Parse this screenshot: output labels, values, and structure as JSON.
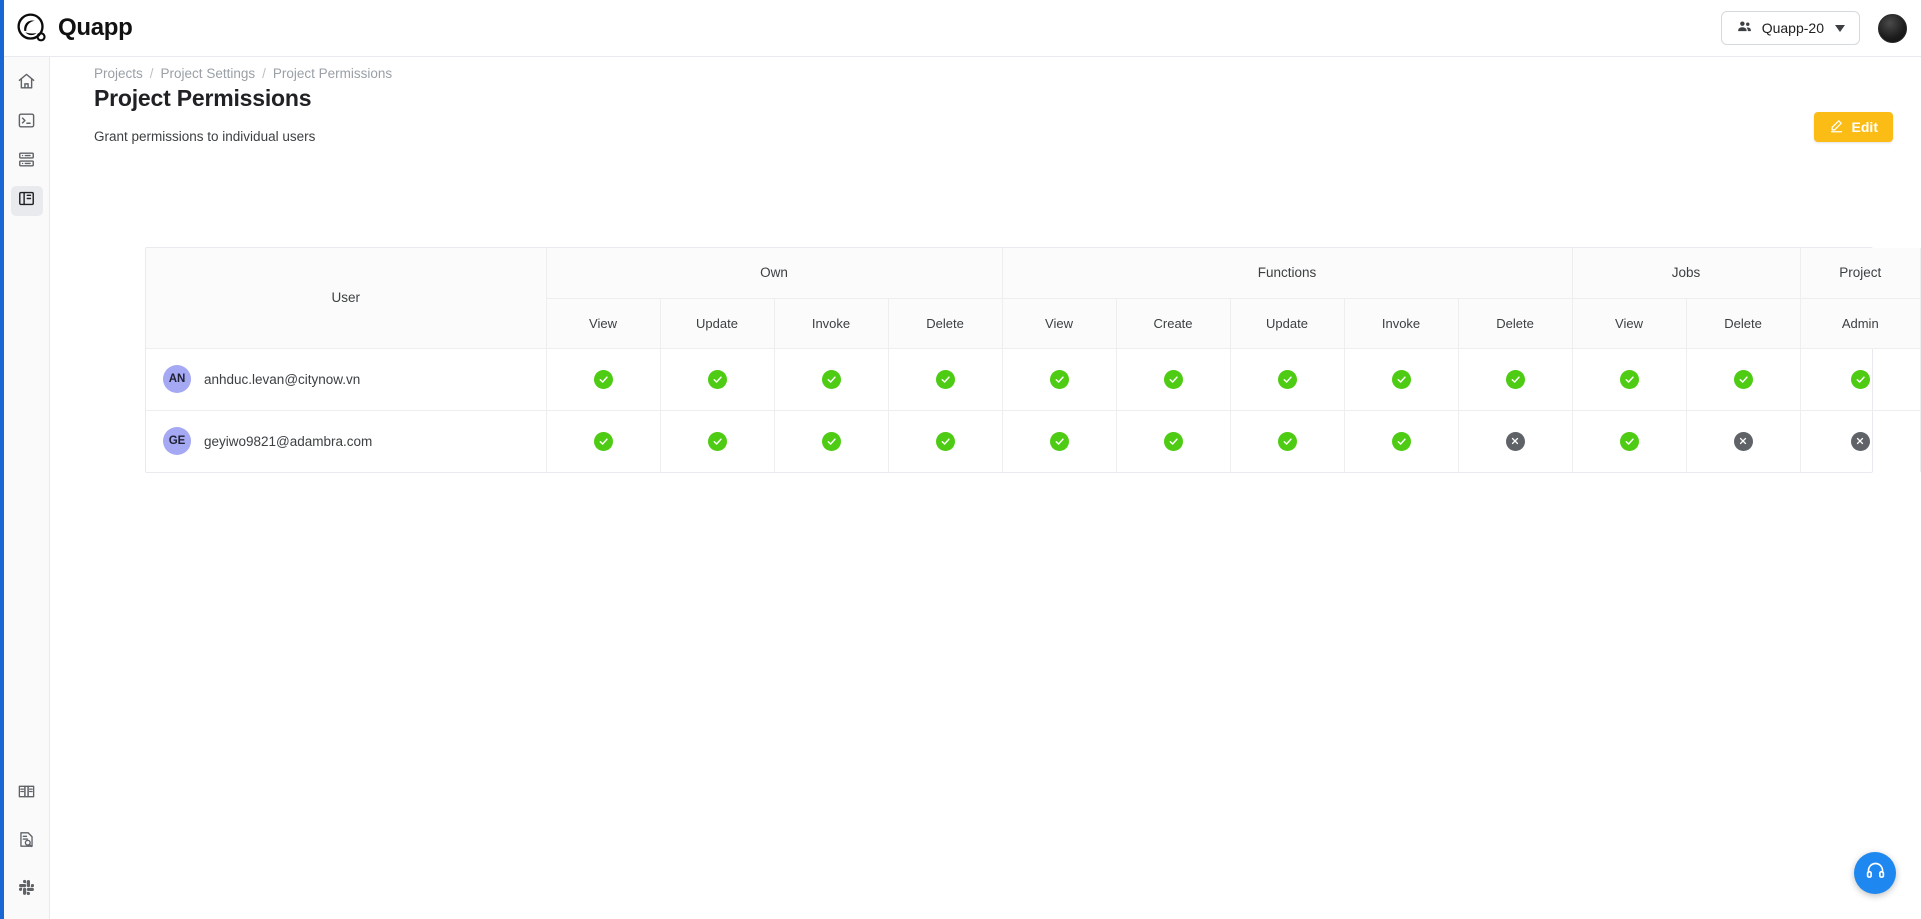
{
  "brand": {
    "name": "Quapp",
    "logo_icon": "quapp-logo-icon"
  },
  "topbar": {
    "org_switcher": {
      "label": "Quapp-20",
      "icon": "people-group-icon",
      "caret_icon": "chevron-down-icon"
    },
    "avatar": {
      "label": ""
    }
  },
  "sidebar": {
    "items": [
      {
        "name": "home",
        "icon": "home-icon",
        "active": false
      },
      {
        "name": "terminal",
        "icon": "terminal-icon",
        "active": false
      },
      {
        "name": "storage",
        "icon": "server-stack-icon",
        "active": false
      },
      {
        "name": "project",
        "icon": "kanban-board-icon",
        "active": true
      }
    ],
    "bottom_items": [
      {
        "name": "docs",
        "icon": "open-book-icon"
      },
      {
        "name": "audit-logs",
        "icon": "document-search-icon"
      },
      {
        "name": "slack",
        "icon": "slack-icon"
      }
    ]
  },
  "breadcrumb": [
    {
      "label": "Projects"
    },
    {
      "label": "Project Settings"
    },
    {
      "label": "Project Permissions"
    }
  ],
  "breadcrumb_separator": "/",
  "page": {
    "title": "Project Permissions",
    "subtitle": "Grant permissions to individual users"
  },
  "actions": {
    "edit": {
      "label": "Edit",
      "icon": "pencil-edit-icon",
      "color": "#fbbc15"
    }
  },
  "table": {
    "user_column_header": "User",
    "groups": [
      {
        "label": "Own",
        "span": 4
      },
      {
        "label": "Functions",
        "span": 5
      },
      {
        "label": "Jobs",
        "span": 2
      },
      {
        "label": "Project",
        "span": 1
      }
    ],
    "sub_headers": [
      "View",
      "Update",
      "Invoke",
      "Delete",
      "View",
      "Create",
      "Update",
      "Invoke",
      "Delete",
      "View",
      "Delete",
      "Admin"
    ],
    "rows": [
      {
        "initials": "AN",
        "email": "anhduc.levan@citynow.vn",
        "avatar_color": "#a5a8f3",
        "permissions": [
          true,
          true,
          true,
          true,
          true,
          true,
          true,
          true,
          true,
          true,
          true,
          true
        ]
      },
      {
        "initials": "GE",
        "email": "geyiwo9821@adambra.com",
        "avatar_color": "#a5a8f3",
        "permissions": [
          true,
          true,
          true,
          true,
          true,
          true,
          true,
          true,
          false,
          true,
          false,
          false
        ]
      }
    ],
    "allow_icon": "check-circle-icon",
    "deny_icon": "x-circle-icon",
    "allow_color": "#4ecb13",
    "deny_color": "#5f6368"
  },
  "support": {
    "icon": "headset-icon",
    "color": "#1e88f0"
  }
}
